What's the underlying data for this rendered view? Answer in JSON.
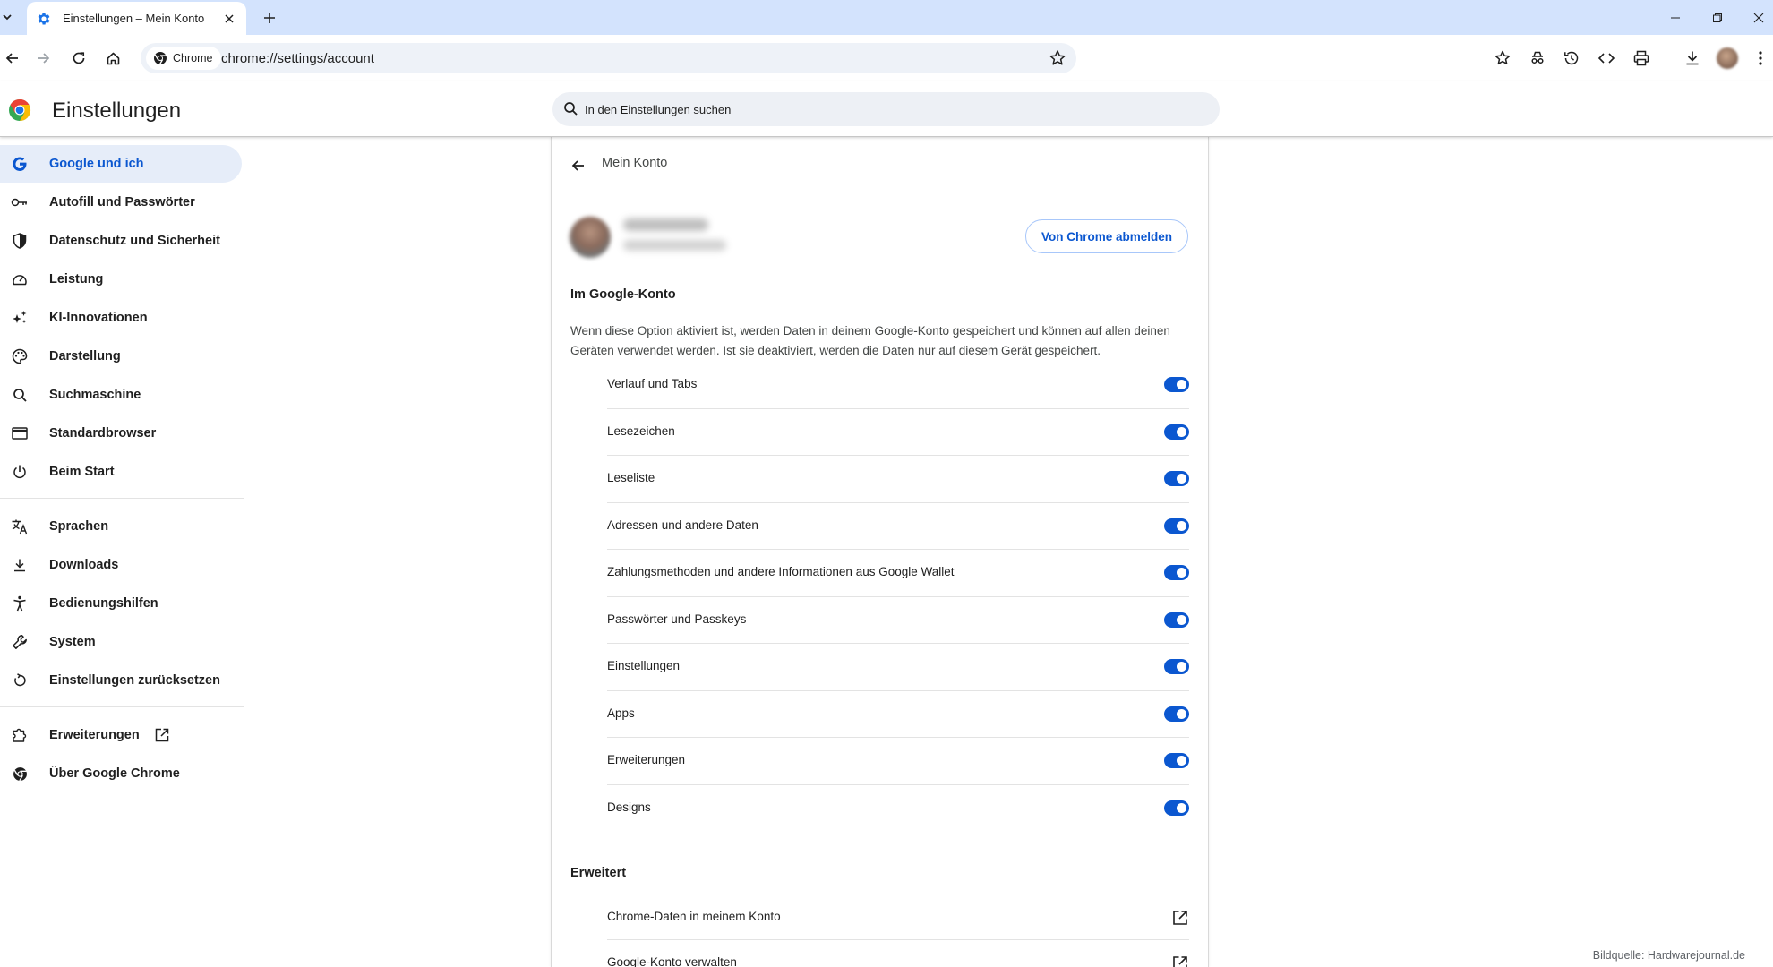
{
  "browser": {
    "tab_title": "Einstellungen – Mein Konto",
    "chip_label": "Chrome",
    "url": "chrome://settings/account"
  },
  "settings": {
    "title": "Einstellungen",
    "search_placeholder": "In den Einstellungen suchen"
  },
  "sidebar": {
    "items": [
      {
        "label": "Google und ich",
        "icon": "google-g-icon",
        "active": true
      },
      {
        "label": "Autofill und Passwörter",
        "icon": "key-icon"
      },
      {
        "label": "Datenschutz und Sicherheit",
        "icon": "shield-icon"
      },
      {
        "label": "Leistung",
        "icon": "speedometer-icon"
      },
      {
        "label": "KI-Innovationen",
        "icon": "sparkle-icon"
      },
      {
        "label": "Darstellung",
        "icon": "palette-icon"
      },
      {
        "label": "Suchmaschine",
        "icon": "search-icon"
      },
      {
        "label": "Standardbrowser",
        "icon": "browser-window-icon"
      },
      {
        "label": "Beim Start",
        "icon": "power-icon"
      },
      {
        "label": "Sprachen",
        "icon": "translate-icon"
      },
      {
        "label": "Downloads",
        "icon": "download-icon"
      },
      {
        "label": "Bedienungshilfen",
        "icon": "accessibility-icon"
      },
      {
        "label": "System",
        "icon": "wrench-icon"
      },
      {
        "label": "Einstellungen zurücksetzen",
        "icon": "reset-icon"
      },
      {
        "label": "Erweiterungen",
        "icon": "puzzle-icon"
      },
      {
        "label": "Über Google Chrome",
        "icon": "chrome-icon"
      }
    ]
  },
  "main": {
    "page_title": "Mein Konto",
    "signout_button": "Von Chrome abmelden",
    "google_account_heading": "Im Google-Konto",
    "description": "Wenn diese Option aktiviert ist, werden Daten in deinem Google-Konto gespeichert und können auf allen deinen Geräten verwendet werden. Ist sie deaktiviert, werden die Daten nur auf diesem Gerät gespeichert.",
    "toggles": [
      {
        "label": "Verlauf und Tabs",
        "on": true
      },
      {
        "label": "Lesezeichen",
        "on": true
      },
      {
        "label": "Leseliste",
        "on": true
      },
      {
        "label": "Adressen und andere Daten",
        "on": true
      },
      {
        "label": "Zahlungsmethoden und andere Informationen aus Google Wallet",
        "on": true
      },
      {
        "label": "Passwörter und Passkeys",
        "on": true
      },
      {
        "label": "Einstellungen",
        "on": true
      },
      {
        "label": "Apps",
        "on": true
      },
      {
        "label": "Erweiterungen",
        "on": true
      },
      {
        "label": "Designs",
        "on": true
      }
    ],
    "advanced_heading": "Erweitert",
    "links": [
      {
        "label": "Chrome-Daten in meinem Konto"
      },
      {
        "label": "Google-Konto verwalten"
      }
    ]
  },
  "watermark": "Bildquelle: Hardwarejournal.de",
  "colors": {
    "accent": "#0b57d0",
    "tabstrip": "#d3e3fd",
    "active_nav": "#e6edf9"
  }
}
